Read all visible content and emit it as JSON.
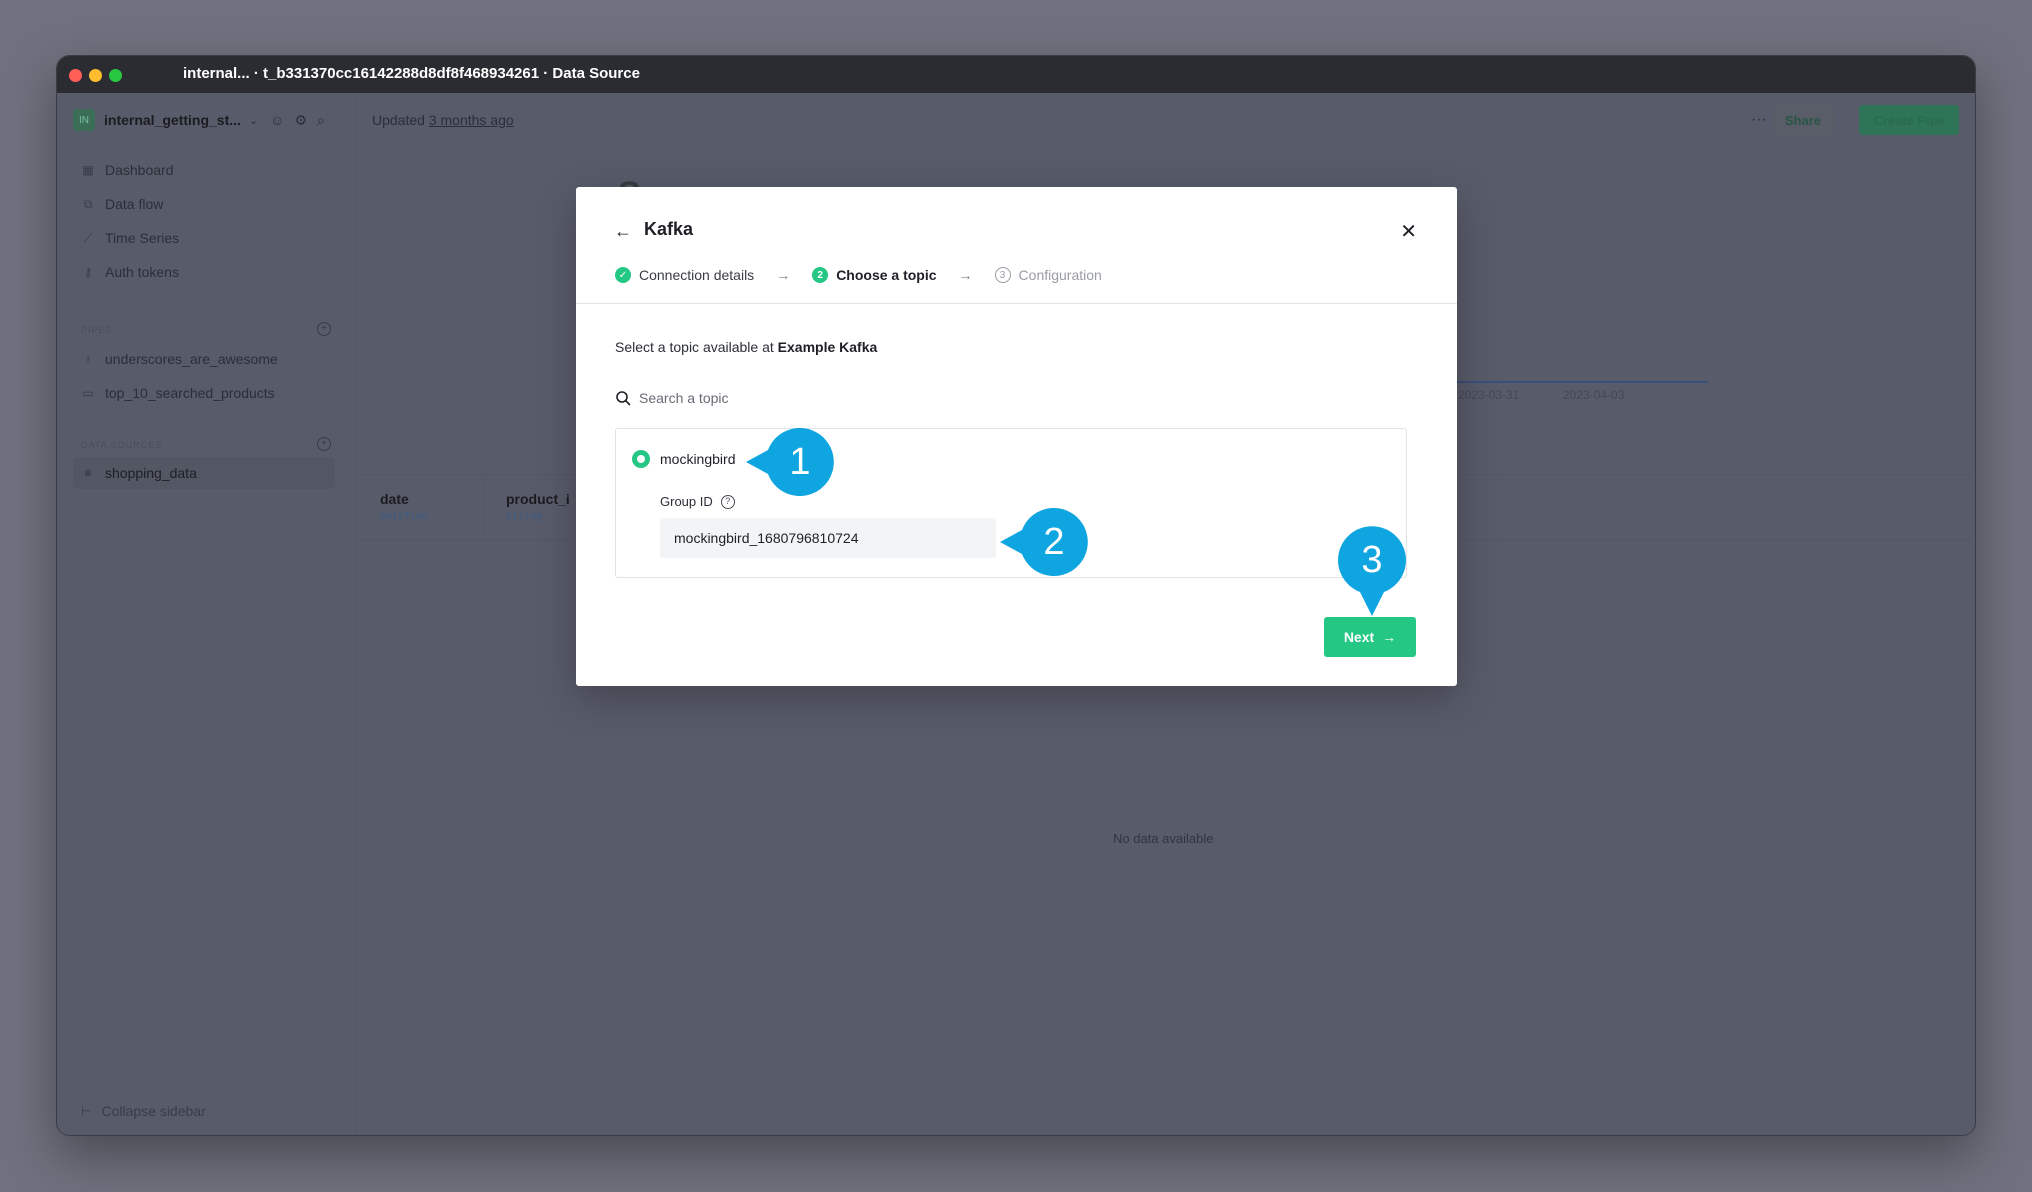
{
  "window": {
    "title": "internal... · t_b331370cc16142288d8df8f468934261 · Data Source"
  },
  "sidebar": {
    "workspace_initials": "IN",
    "workspace_name": "internal_getting_st...",
    "nav": [
      {
        "label": "Dashboard",
        "icon": "grid-icon"
      },
      {
        "label": "Data flow",
        "icon": "flow-icon"
      },
      {
        "label": "Time Series",
        "icon": "chart-icon"
      },
      {
        "label": "Auth tokens",
        "icon": "key-icon"
      }
    ],
    "pipes_label": "PIPES",
    "pipes": [
      {
        "label": "underscores_are_awesome",
        "icon": "pipe-icon"
      },
      {
        "label": "top_10_searched_products",
        "icon": "pipe-icon"
      }
    ],
    "datasources_label": "DATA SOURCES",
    "datasource": {
      "label": "shopping_data",
      "icon": "database-icon"
    },
    "collapse_label": "Collapse sidebar"
  },
  "main": {
    "updated_prefix": "Updated ",
    "updated_time": "3 months ago",
    "more_label": "···",
    "share_label": "Share",
    "create_label": "Create Pipe",
    "bg_title": "S",
    "ticks": [
      "2023-03-31",
      "2023-04-03"
    ],
    "columns": [
      {
        "name": "date",
        "type": "DateTime"
      },
      {
        "name": "product_i",
        "type": "String"
      }
    ],
    "no_data": "No data available"
  },
  "modal": {
    "title": "Kafka",
    "steps": [
      {
        "label": "Connection details",
        "state": "done",
        "badge": "✓"
      },
      {
        "label": "Choose a topic",
        "state": "active",
        "badge": "2"
      },
      {
        "label": "Configuration",
        "state": "todo",
        "badge": "3"
      }
    ],
    "intro_prefix": "Select a topic available at ",
    "intro_source": "Example Kafka",
    "search_placeholder": "Search a topic",
    "topic": "mockingbird",
    "group_label": "Group ID",
    "group_value": "mockingbird_1680796810724",
    "next_label": "Next"
  },
  "callouts": [
    "1",
    "2",
    "3"
  ],
  "colors": {
    "accent": "#25c784",
    "callout": "#0ea5e0"
  }
}
